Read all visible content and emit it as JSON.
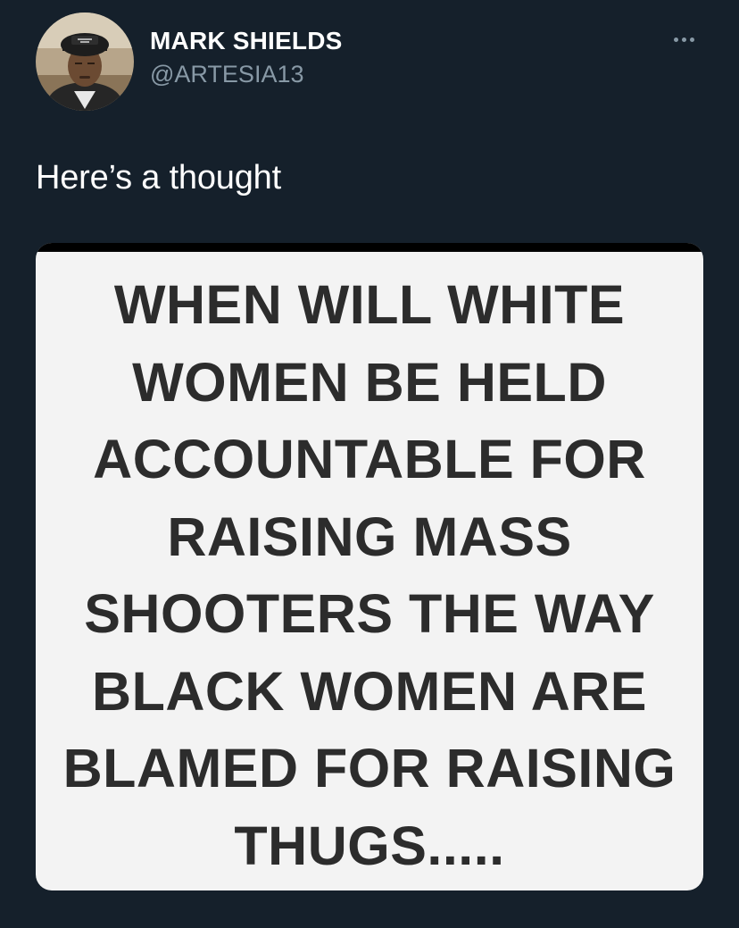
{
  "author": {
    "display_name": "MARK SHIELDS",
    "handle": "@ARTESIA13"
  },
  "tweet": {
    "text": "Here’s a thought"
  },
  "media": {
    "lines": [
      "WHEN WILL WHITE",
      "WOMEN BE HELD",
      "ACCOUNTABLE FOR",
      "RAISING MASS",
      "SHOOTERS THE WAY",
      "BLACK WOMEN ARE",
      "BLAMED FOR RAISING",
      "THUGS....."
    ]
  },
  "icons": {
    "more": "more-options-icon",
    "avatar": "profile-photo"
  },
  "colors": {
    "background": "#15202b",
    "secondary_text": "#8899a6",
    "primary_text": "#ffffff",
    "meme_background": "#f3f3f3",
    "meme_text": "#2c2c2c"
  }
}
